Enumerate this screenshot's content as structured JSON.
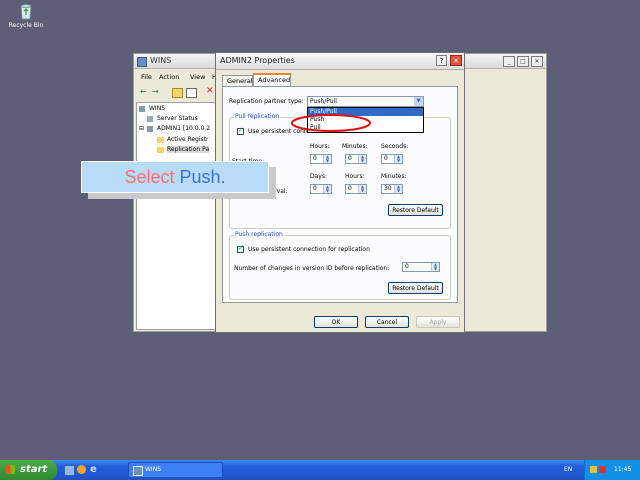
{
  "desktop": {
    "recycle_bin_label": "Recycle Bin"
  },
  "wins_window": {
    "title": "WINS",
    "menu": [
      "File",
      "Action",
      "View",
      "H"
    ],
    "tree": [
      "WINS",
      "Server Status",
      "ADMIN1 [10.0.0.2",
      "Active Registr",
      "Replication Pa"
    ]
  },
  "dialog": {
    "title": "ADMIN2 Properties",
    "help_glyph": "?",
    "close_glyph": "✕",
    "tabs": [
      "General",
      "Advanced"
    ],
    "partner_type_label": "Replication partner type:",
    "partner_type_value": "Push/Pull",
    "dropdown_options": [
      "Push/Pull",
      "Push",
      "Pull"
    ],
    "pull": {
      "group_title": "Pull replication",
      "persistent_label": "Use persistent conn",
      "start_time_label": "Start time:",
      "hours_label": "Hours:",
      "minutes_label": "Minutes:",
      "seconds_label": "Seconds:",
      "start_hours": "0",
      "start_minutes": "0",
      "start_seconds": "0",
      "interval_label": "n interval:",
      "days_label": "Days:",
      "int_days": "0",
      "int_hours": "0",
      "int_minutes": "30",
      "restore_default": "Restore Default"
    },
    "push": {
      "group_title": "Push replication",
      "persistent_label": "Use persistent connection for replication",
      "changes_label": "Number of changes in version ID before replication:",
      "changes_value": "0",
      "restore_default": "Restore Default"
    },
    "ok": "OK",
    "cancel": "Cancel",
    "apply": "Apply"
  },
  "callout": {
    "text_pre": "Select ",
    "text_highlight": "Push.",
    "text_pre_color": "#ff6d6d",
    "text_highlight_color": "#3c6fd9"
  },
  "taskbar": {
    "start_label": "start",
    "task_label": "WINS",
    "lang": "EN",
    "clock": "11:45"
  }
}
